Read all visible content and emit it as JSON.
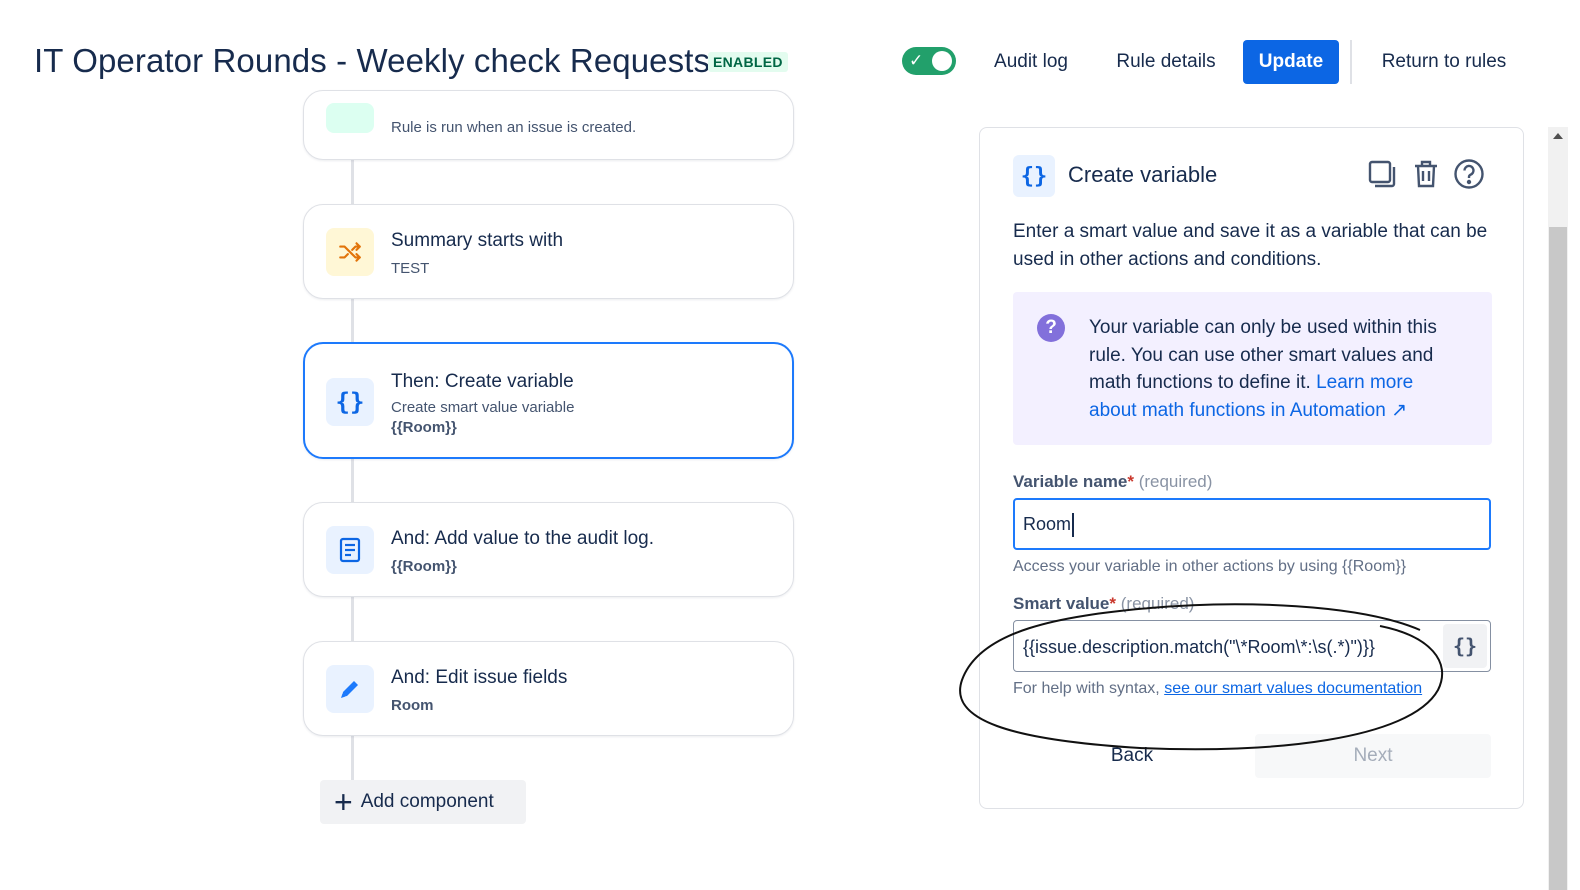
{
  "header": {
    "title": "IT Operator Rounds - Weekly check Requests",
    "status": "ENABLED",
    "toggle_on": true,
    "audit_log": "Audit log",
    "rule_details": "Rule details",
    "update": "Update",
    "return_to_rules": "Return to rules"
  },
  "flow": {
    "trigger": {
      "subtitle": "Rule is run when an issue is created."
    },
    "steps": [
      {
        "title": "Summary starts with",
        "subtitle": "TEST",
        "icon": "shuffle-icon"
      },
      {
        "title": "Then: Create variable",
        "subtitle": "Create smart value variable",
        "detail": "{{Room}}",
        "icon": "braces-icon"
      },
      {
        "title": "And: Add value to the audit log.",
        "detail": "{{Room}}",
        "icon": "document-icon"
      },
      {
        "title": "And: Edit issue fields",
        "detail": "Room",
        "icon": "pencil-icon"
      }
    ],
    "add_component": "Add component"
  },
  "panel": {
    "title": "Create variable",
    "description": "Enter a smart value and save it as a variable that can be used in other actions and conditions.",
    "info": {
      "text": "Your variable can only be used within this rule. You can use other smart values and math functions to define it.",
      "link": "Learn more about math functions in Automation ↗"
    },
    "variable_name": {
      "label": "Variable name",
      "required_mark": "*",
      "hint": "(required)",
      "value": "Room",
      "help": "Access your variable in other actions by using {{Room}}"
    },
    "smart_value": {
      "label": "Smart value",
      "required_mark": "*",
      "hint": "(required)",
      "value": "{{issue.description.match(\"\\*Room\\*:\\s(.*)\")}}",
      "help_prefix": "For help with syntax,",
      "help_link": "see our smart values documentation"
    },
    "back": "Back",
    "next": "Next"
  },
  "colors": {
    "brand_blue": "#0c66e4",
    "selected_border": "#1d7afc",
    "toggle_green": "#22a06b",
    "enabled_text": "#006644",
    "info_bg": "#f3f0ff",
    "info_icon": "#8270db"
  }
}
